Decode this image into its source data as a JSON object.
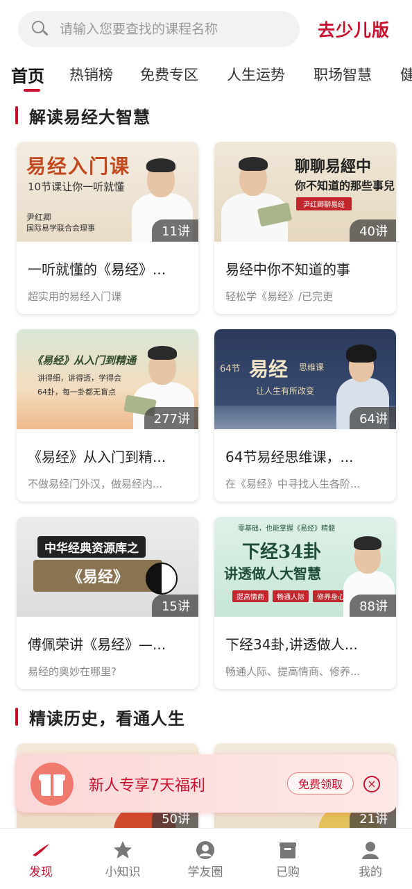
{
  "header": {
    "search_placeholder": "请输入您要查找的课程名称",
    "search_icon": "search-icon",
    "kids_link": "去少儿版"
  },
  "tabs": [
    {
      "label": "首页",
      "active": true
    },
    {
      "label": "热销榜"
    },
    {
      "label": "免费专区"
    },
    {
      "label": "人生运势"
    },
    {
      "label": "职场智慧"
    },
    {
      "label": "健"
    }
  ],
  "sections": [
    {
      "title": "解读易经大智慧",
      "courses": [
        {
          "thumb_lines": [
            "易经入门课",
            "10节课让你一听就懂",
            "尹红卿",
            "国际易学联合会理事"
          ],
          "count": "11讲",
          "title": "一听就懂的《易经》...",
          "subtitle": "超实用的易经入门课"
        },
        {
          "thumb_lines": [
            "聊聊易經中",
            "你不知道的那些事兒",
            "尹红卿聊易经"
          ],
          "count": "40讲",
          "title": "易经中你不知道的事",
          "subtitle": "轻松学《易经》/已完更"
        },
        {
          "thumb_lines": [
            "《易经》从入门到精通",
            "讲得细，讲得透，学得会",
            "64卦，每一卦都无盲点"
          ],
          "count": "277讲",
          "title": "《易经》从入门到精...",
          "subtitle": "不做易经门外汉，做易经内..."
        },
        {
          "thumb_lines": [
            "64节",
            "易经",
            "思维课",
            "让人生有所改变"
          ],
          "count": "64讲",
          "title": "64节易经思维课，...",
          "subtitle": "在《易经》中寻找人生各阶..."
        },
        {
          "thumb_lines": [
            "中华经典资源库之",
            "《易经》"
          ],
          "count": "15讲",
          "title": "傅佩荣讲《易经》—...",
          "subtitle": "易经的奥妙在哪里?"
        },
        {
          "thumb_lines": [
            "零基础，也能掌握《易经》精髓",
            "下经34卦",
            "讲透做人大智慧",
            "提高情商",
            "畅通人际",
            "修养身心"
          ],
          "count": "88讲",
          "title": "下经34卦,讲透做人...",
          "subtitle": "畅通人际、提高情商、修养..."
        }
      ]
    },
    {
      "title": "精读历史，看通人生",
      "courses": [
        {
          "count": "50讲"
        },
        {
          "count": "21讲"
        }
      ]
    }
  ],
  "promo": {
    "icon": "gift-icon",
    "text": "新人专享7天福利",
    "button": "免费领取",
    "close": "×"
  },
  "bottom_nav": [
    {
      "label": "发现",
      "icon": "discover-icon",
      "active": true
    },
    {
      "label": "小知识",
      "icon": "star-icon"
    },
    {
      "label": "学友圈",
      "icon": "community-icon"
    },
    {
      "label": "已购",
      "icon": "purchased-icon"
    },
    {
      "label": "我的",
      "icon": "profile-icon"
    }
  ],
  "colors": {
    "accent": "#c8102e",
    "badge_bg": "#3c3c3c"
  }
}
